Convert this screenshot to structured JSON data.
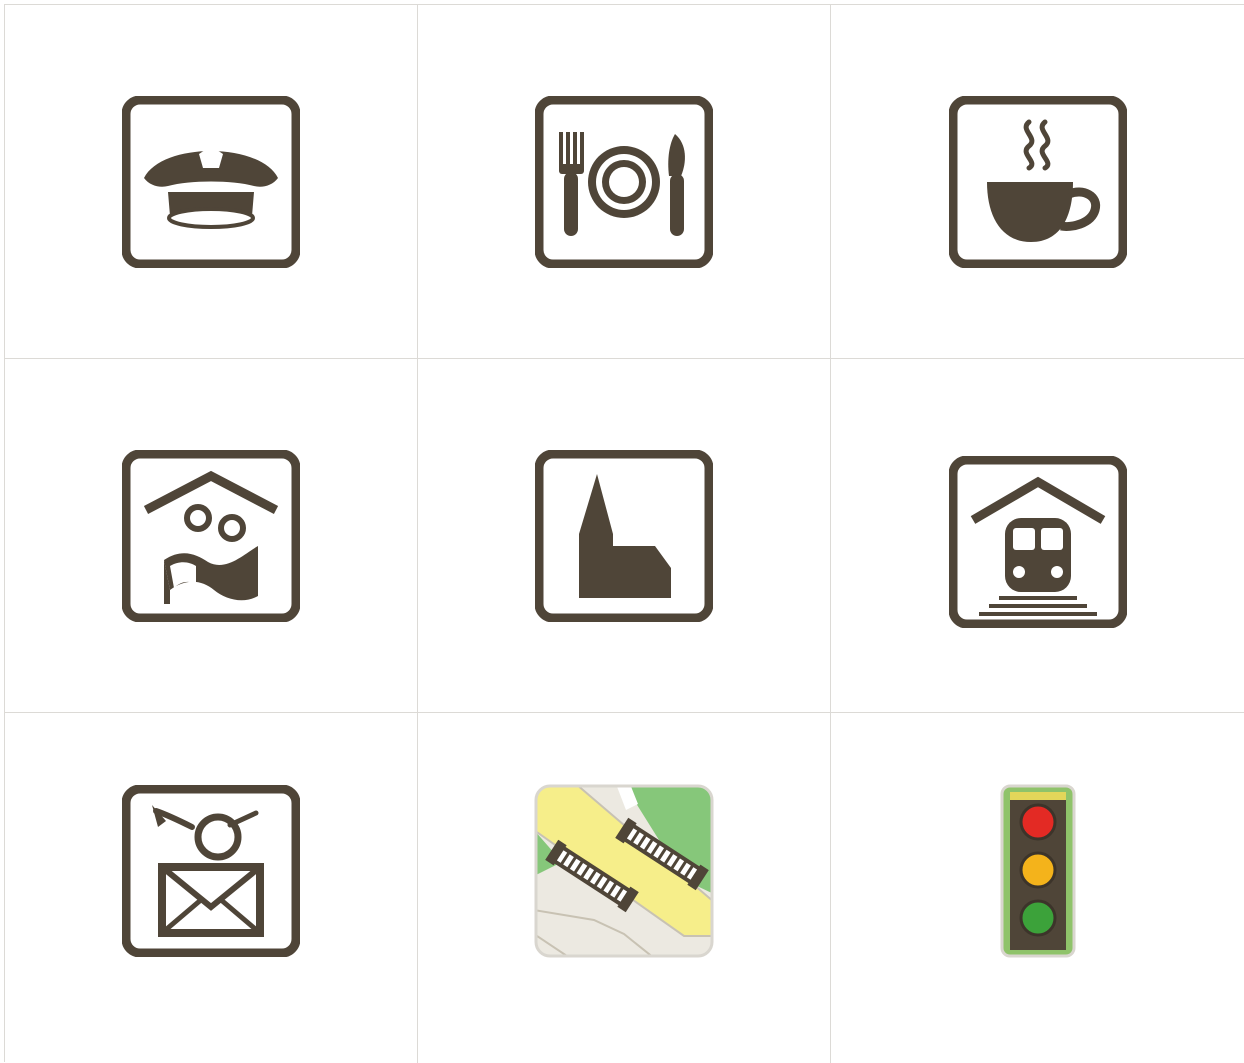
{
  "icons": [
    {
      "icon": "police-cap-icon"
    },
    {
      "icon": "restaurant-icon"
    },
    {
      "icon": "cafe-icon"
    },
    {
      "icon": "tourist-info-icon"
    },
    {
      "icon": "church-icon"
    },
    {
      "icon": "train-station-icon"
    },
    {
      "icon": "post-office-icon"
    },
    {
      "icon": "railroad-crossing-map-icon"
    },
    {
      "icon": "traffic-light-icon"
    }
  ],
  "colors": {
    "icon_fill": "#4f4538",
    "grid_line": "#dcdad6",
    "background": "#ffffff",
    "map_road": "#f6ee8a",
    "map_green": "#86c77a",
    "map_ground": "#ece9e1",
    "light_red": "#e32a24",
    "light_amber": "#f4b31b",
    "light_green": "#3ca23a",
    "signal_housing": "#8fc36a"
  }
}
